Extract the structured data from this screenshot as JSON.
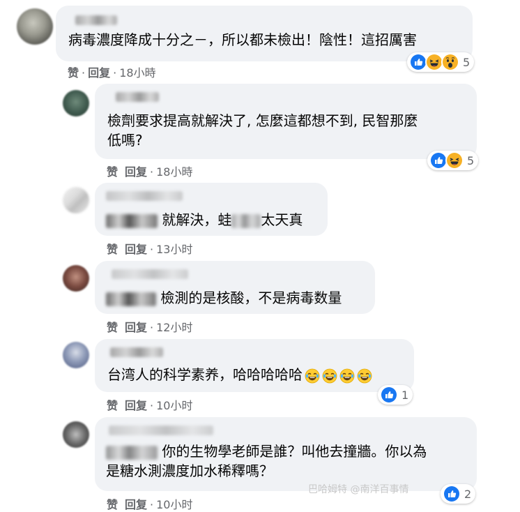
{
  "comments": [
    {
      "text": "病毒濃度降成十分之－，所以都未檢出！陰性！這招厲害",
      "time": "18小時",
      "reaction_count": "5"
    },
    {
      "text_line1": "檢劑要求提高就解決了, 怎麼這都想不到, 民智那麼",
      "text_line2": "低嗎?",
      "time": "18小時",
      "reaction_count": "5"
    },
    {
      "text_a": "就解決，蛙",
      "text_b": "太天真",
      "time": "13小时"
    },
    {
      "text": "檢測的是核酸，不是病毒数量",
      "time": "12小时"
    },
    {
      "text": "台湾人的科学素养，哈哈哈哈哈",
      "time": "10小时",
      "reaction_count": "1"
    },
    {
      "text_line1": "你的生物學老師是誰？叫他去撞牆。你以為",
      "text_line2": "是糖水測濃度加水稀釋嗎？",
      "time": "10小时",
      "reaction_count": "2"
    }
  ],
  "actions": {
    "like": "赞",
    "reply": "回复"
  },
  "watermark": "巴哈姆特 @南洋百事情",
  "icons": {
    "like": "like-reaction-icon",
    "haha": "haha-reaction-icon",
    "wow": "wow-reaction-icon",
    "laugh": "laugh-cry-emoji"
  },
  "colors": {
    "bubble": "#f0f2f5",
    "meta": "#65676b",
    "like_blue": "#1877f2",
    "haha_yellow": "#f7b125"
  }
}
